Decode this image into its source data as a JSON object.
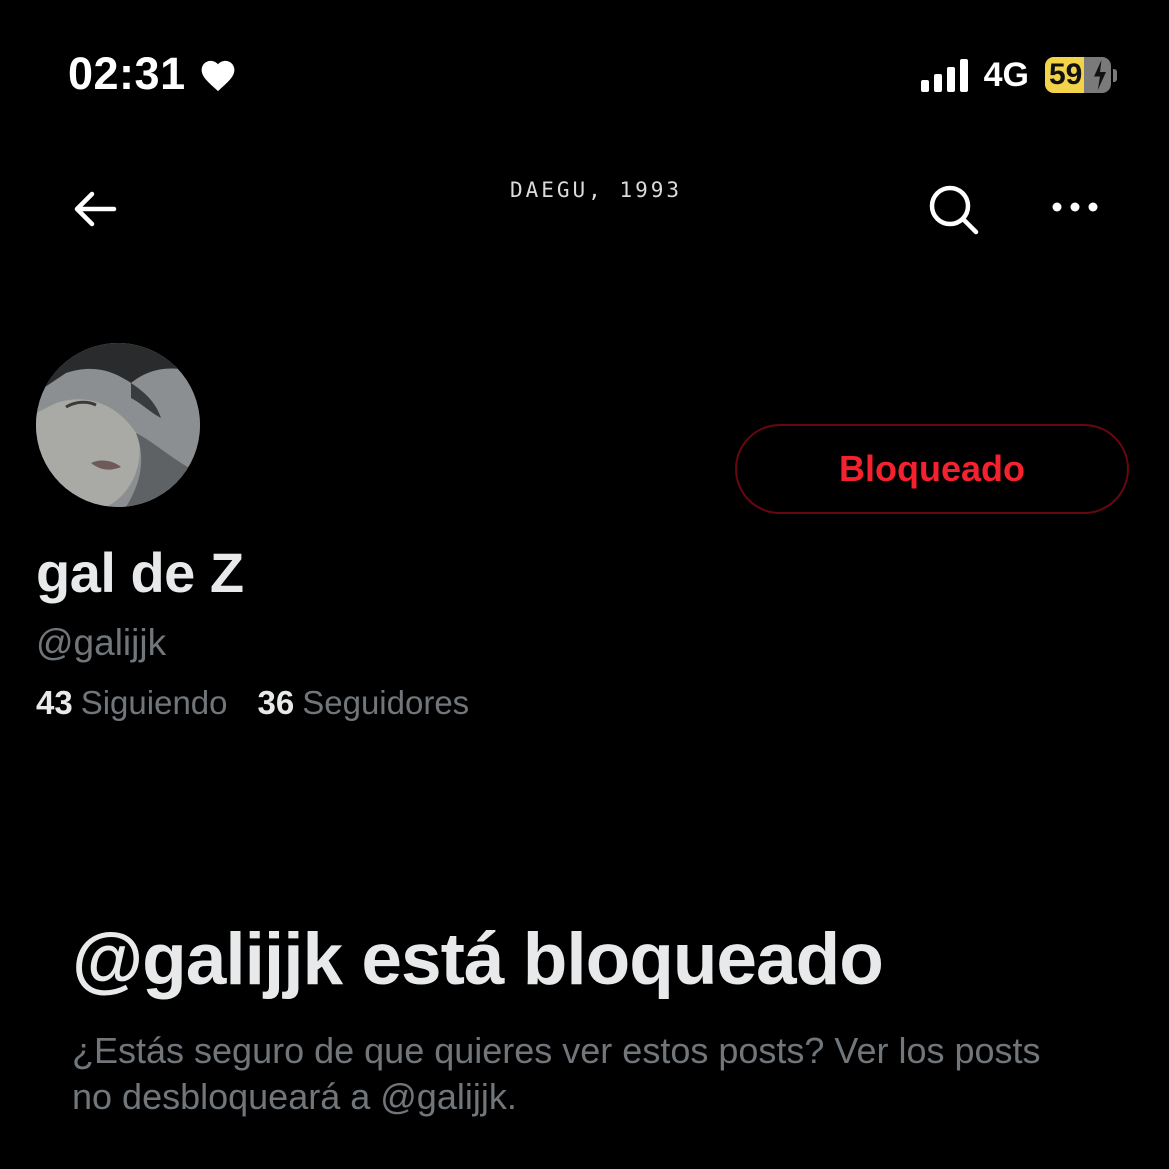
{
  "status_bar": {
    "time": "02:31",
    "network": "4G",
    "battery_level": "59",
    "battery_fraction": 0.59
  },
  "header": {
    "title": "DAEGU, 1993"
  },
  "profile": {
    "display_name": "gal de Z",
    "handle": "@galijjk",
    "blocked_label": "Bloqueado",
    "following_count": "43",
    "following_label": "Siguiendo",
    "followers_count": "36",
    "followers_label": "Seguidores"
  },
  "blocked_notice": {
    "title": "@galijjk está bloqueado",
    "description": "¿Estás seguro de que quieres ver estos posts? Ver los posts no desbloqueará a @galijjk."
  },
  "colors": {
    "background": "#000000",
    "primary_text": "#e7e9ea",
    "secondary_text": "#71767b",
    "blocked_red": "#f4212e",
    "blocked_border": "#67070f",
    "battery_yellow": "#f2d34a"
  },
  "icons": {
    "status_heart": "heart-icon",
    "signal": "signal-bars-icon",
    "back": "arrow-left-icon",
    "search": "search-icon",
    "more": "more-horizontal-icon"
  }
}
